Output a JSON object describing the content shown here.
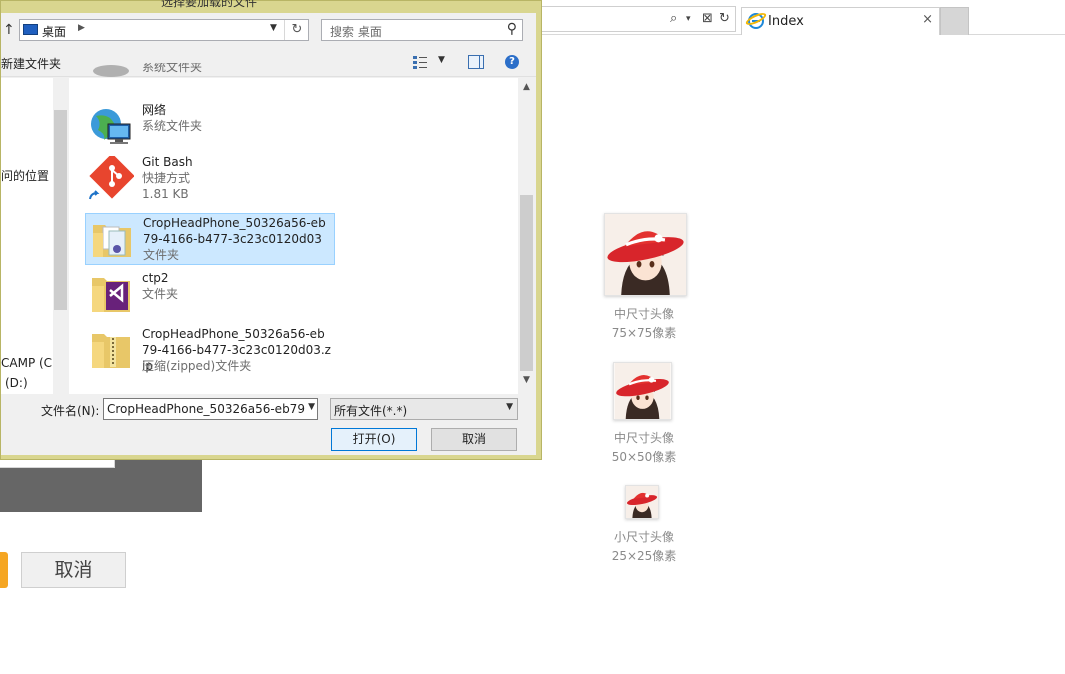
{
  "browser": {
    "tab_title": "Index",
    "tab_close": "×",
    "address_icons": [
      "⌕",
      "▾",
      "⊠",
      "↻"
    ]
  },
  "page": {
    "cancel_label": "取消",
    "avatars": [
      {
        "title": "中尺寸头像",
        "size": "75×75像素"
      },
      {
        "title": "中尺寸头像",
        "size": "50×50像素"
      },
      {
        "title": "小尺寸头像",
        "size": "25×25像素"
      }
    ]
  },
  "dialog": {
    "title": "选择要加载的文件",
    "path_label": "桌面",
    "search_placeholder": "搜索 桌面",
    "new_folder": "新建文件夹",
    "help": "?",
    "nav_items": [
      "问的位置",
      "CAMP (C:",
      "(D:)"
    ],
    "files": [
      {
        "name": "系统文件夹",
        "sub": ""
      },
      {
        "name": "网络",
        "sub": "系统文件夹",
        "sub2": ""
      },
      {
        "name": "Git Bash",
        "sub": "快捷方式",
        "sub2": "1.81 KB"
      },
      {
        "name": "CropHeadPhone_50326a56-eb79-4166-b477-3c23c0120d03",
        "sub": "文件夹",
        "sub2": ""
      },
      {
        "name": "ctp2",
        "sub": "文件夹",
        "sub2": ""
      },
      {
        "name": "CropHeadPhone_50326a56-eb79-4166-b477-3c23c0120d03.zip",
        "sub": "压缩(zipped)文件夹",
        "sub2": ""
      }
    ],
    "filename_label": "文件名(N):",
    "filename_value": "CropHeadPhone_50326a56-eb79",
    "filetype_value": "所有文件(*.*)",
    "open_label": "打开(O)",
    "cancel_label": "取消"
  },
  "colors": {
    "accent": "#0078d7",
    "selection": "#cce8ff",
    "orange_button": "#f5a623",
    "dialog_frame": "#d9d68f"
  }
}
